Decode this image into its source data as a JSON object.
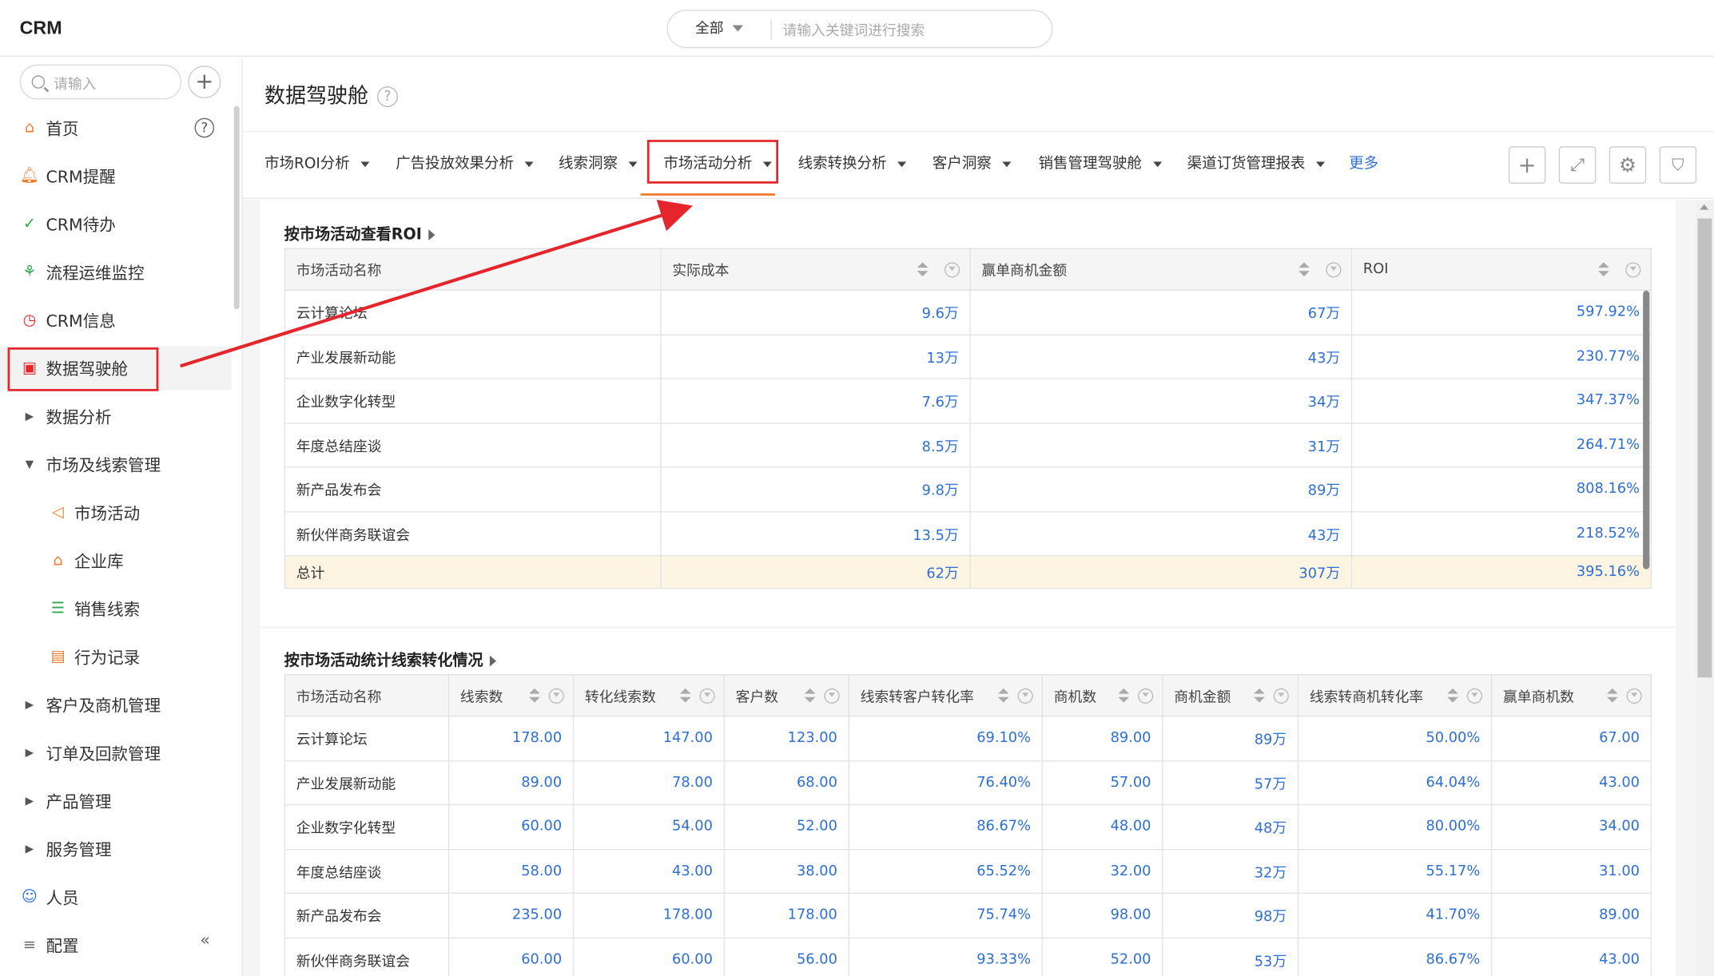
{
  "app": {
    "title": "CRM"
  },
  "search": {
    "scope": "全部",
    "placeholder": "请输入关键词进行搜索"
  },
  "sidebar": {
    "search_placeholder": "请输入",
    "items": [
      {
        "label": "首页",
        "icon": "home-icon"
      },
      {
        "label": "CRM提醒",
        "icon": "bell-icon"
      },
      {
        "label": "CRM待办",
        "icon": "check-circle-icon"
      },
      {
        "label": "流程运维监控",
        "icon": "flow-icon"
      },
      {
        "label": "CRM信息",
        "icon": "clock-icon"
      },
      {
        "label": "数据驾驶舱",
        "icon": "dashboard-icon"
      },
      {
        "label": "数据分析",
        "icon": "caret-right-icon"
      },
      {
        "label": "市场及线索管理",
        "icon": "caret-down-icon"
      },
      {
        "label": "市场活动",
        "icon": "megaphone-icon"
      },
      {
        "label": "企业库",
        "icon": "building-icon"
      },
      {
        "label": "销售线索",
        "icon": "leads-icon"
      },
      {
        "label": "行为记录",
        "icon": "record-icon"
      },
      {
        "label": "客户及商机管理",
        "icon": "caret-right-icon"
      },
      {
        "label": "订单及回款管理",
        "icon": "caret-right-icon"
      },
      {
        "label": "产品管理",
        "icon": "caret-right-icon"
      },
      {
        "label": "服务管理",
        "icon": "caret-right-icon"
      },
      {
        "label": "人员",
        "icon": "people-icon"
      },
      {
        "label": "配置",
        "icon": "settings-icon"
      }
    ]
  },
  "page": {
    "title": "数据驾驶舱"
  },
  "tabs": [
    "市场ROI分析",
    "广告投放效果分析",
    "线索洞察",
    "市场活动分析",
    "线索转换分析",
    "客户洞察",
    "销售管理驾驶舱",
    "渠道订货管理报表"
  ],
  "tabs_more": "更多",
  "active_tab": "市场活动分析",
  "roi_table": {
    "title": "按市场活动查看ROI",
    "headers": [
      "市场活动名称",
      "实际成本",
      "赢单商机金额",
      "ROI"
    ],
    "rows": [
      [
        "云计算论坛",
        "9.6万",
        "67万",
        "597.92%"
      ],
      [
        "产业发展新动能",
        "13万",
        "43万",
        "230.77%"
      ],
      [
        "企业数字化转型",
        "7.6万",
        "34万",
        "347.37%"
      ],
      [
        "年度总结座谈",
        "8.5万",
        "31万",
        "264.71%"
      ],
      [
        "新产品发布会",
        "9.8万",
        "89万",
        "808.16%"
      ],
      [
        "新伙伴商务联谊会",
        "13.5万",
        "43万",
        "218.52%"
      ]
    ],
    "total": [
      "总计",
      "62万",
      "307万",
      "395.16%"
    ]
  },
  "lead_table": {
    "title": "按市场活动统计线索转化情况",
    "headers": [
      "市场活动名称",
      "线索数",
      "转化线索数",
      "客户数",
      "线索转客户转化率",
      "商机数",
      "商机金额",
      "线索转商机转化率",
      "赢单商机数"
    ],
    "rows": [
      [
        "云计算论坛",
        "178.00",
        "147.00",
        "123.00",
        "69.10%",
        "89.00",
        "89万",
        "50.00%",
        "67.00"
      ],
      [
        "产业发展新动能",
        "89.00",
        "78.00",
        "68.00",
        "76.40%",
        "57.00",
        "57万",
        "64.04%",
        "43.00"
      ],
      [
        "企业数字化转型",
        "60.00",
        "54.00",
        "52.00",
        "86.67%",
        "48.00",
        "48万",
        "80.00%",
        "34.00"
      ],
      [
        "年度总结座谈",
        "58.00",
        "43.00",
        "38.00",
        "65.52%",
        "32.00",
        "32万",
        "55.17%",
        "31.00"
      ],
      [
        "新产品发布会",
        "235.00",
        "178.00",
        "178.00",
        "75.74%",
        "98.00",
        "98万",
        "41.70%",
        "89.00"
      ],
      [
        "新伙伴商务联谊会",
        "60.00",
        "60.00",
        "56.00",
        "93.33%",
        "52.00",
        "53万",
        "86.67%",
        "43.00"
      ]
    ]
  },
  "colors": {
    "accent": "#2e6fd6",
    "highlight_red": "#e4262c",
    "tab_underline": "#f07a2a",
    "total_row": "#fdf4e1"
  }
}
